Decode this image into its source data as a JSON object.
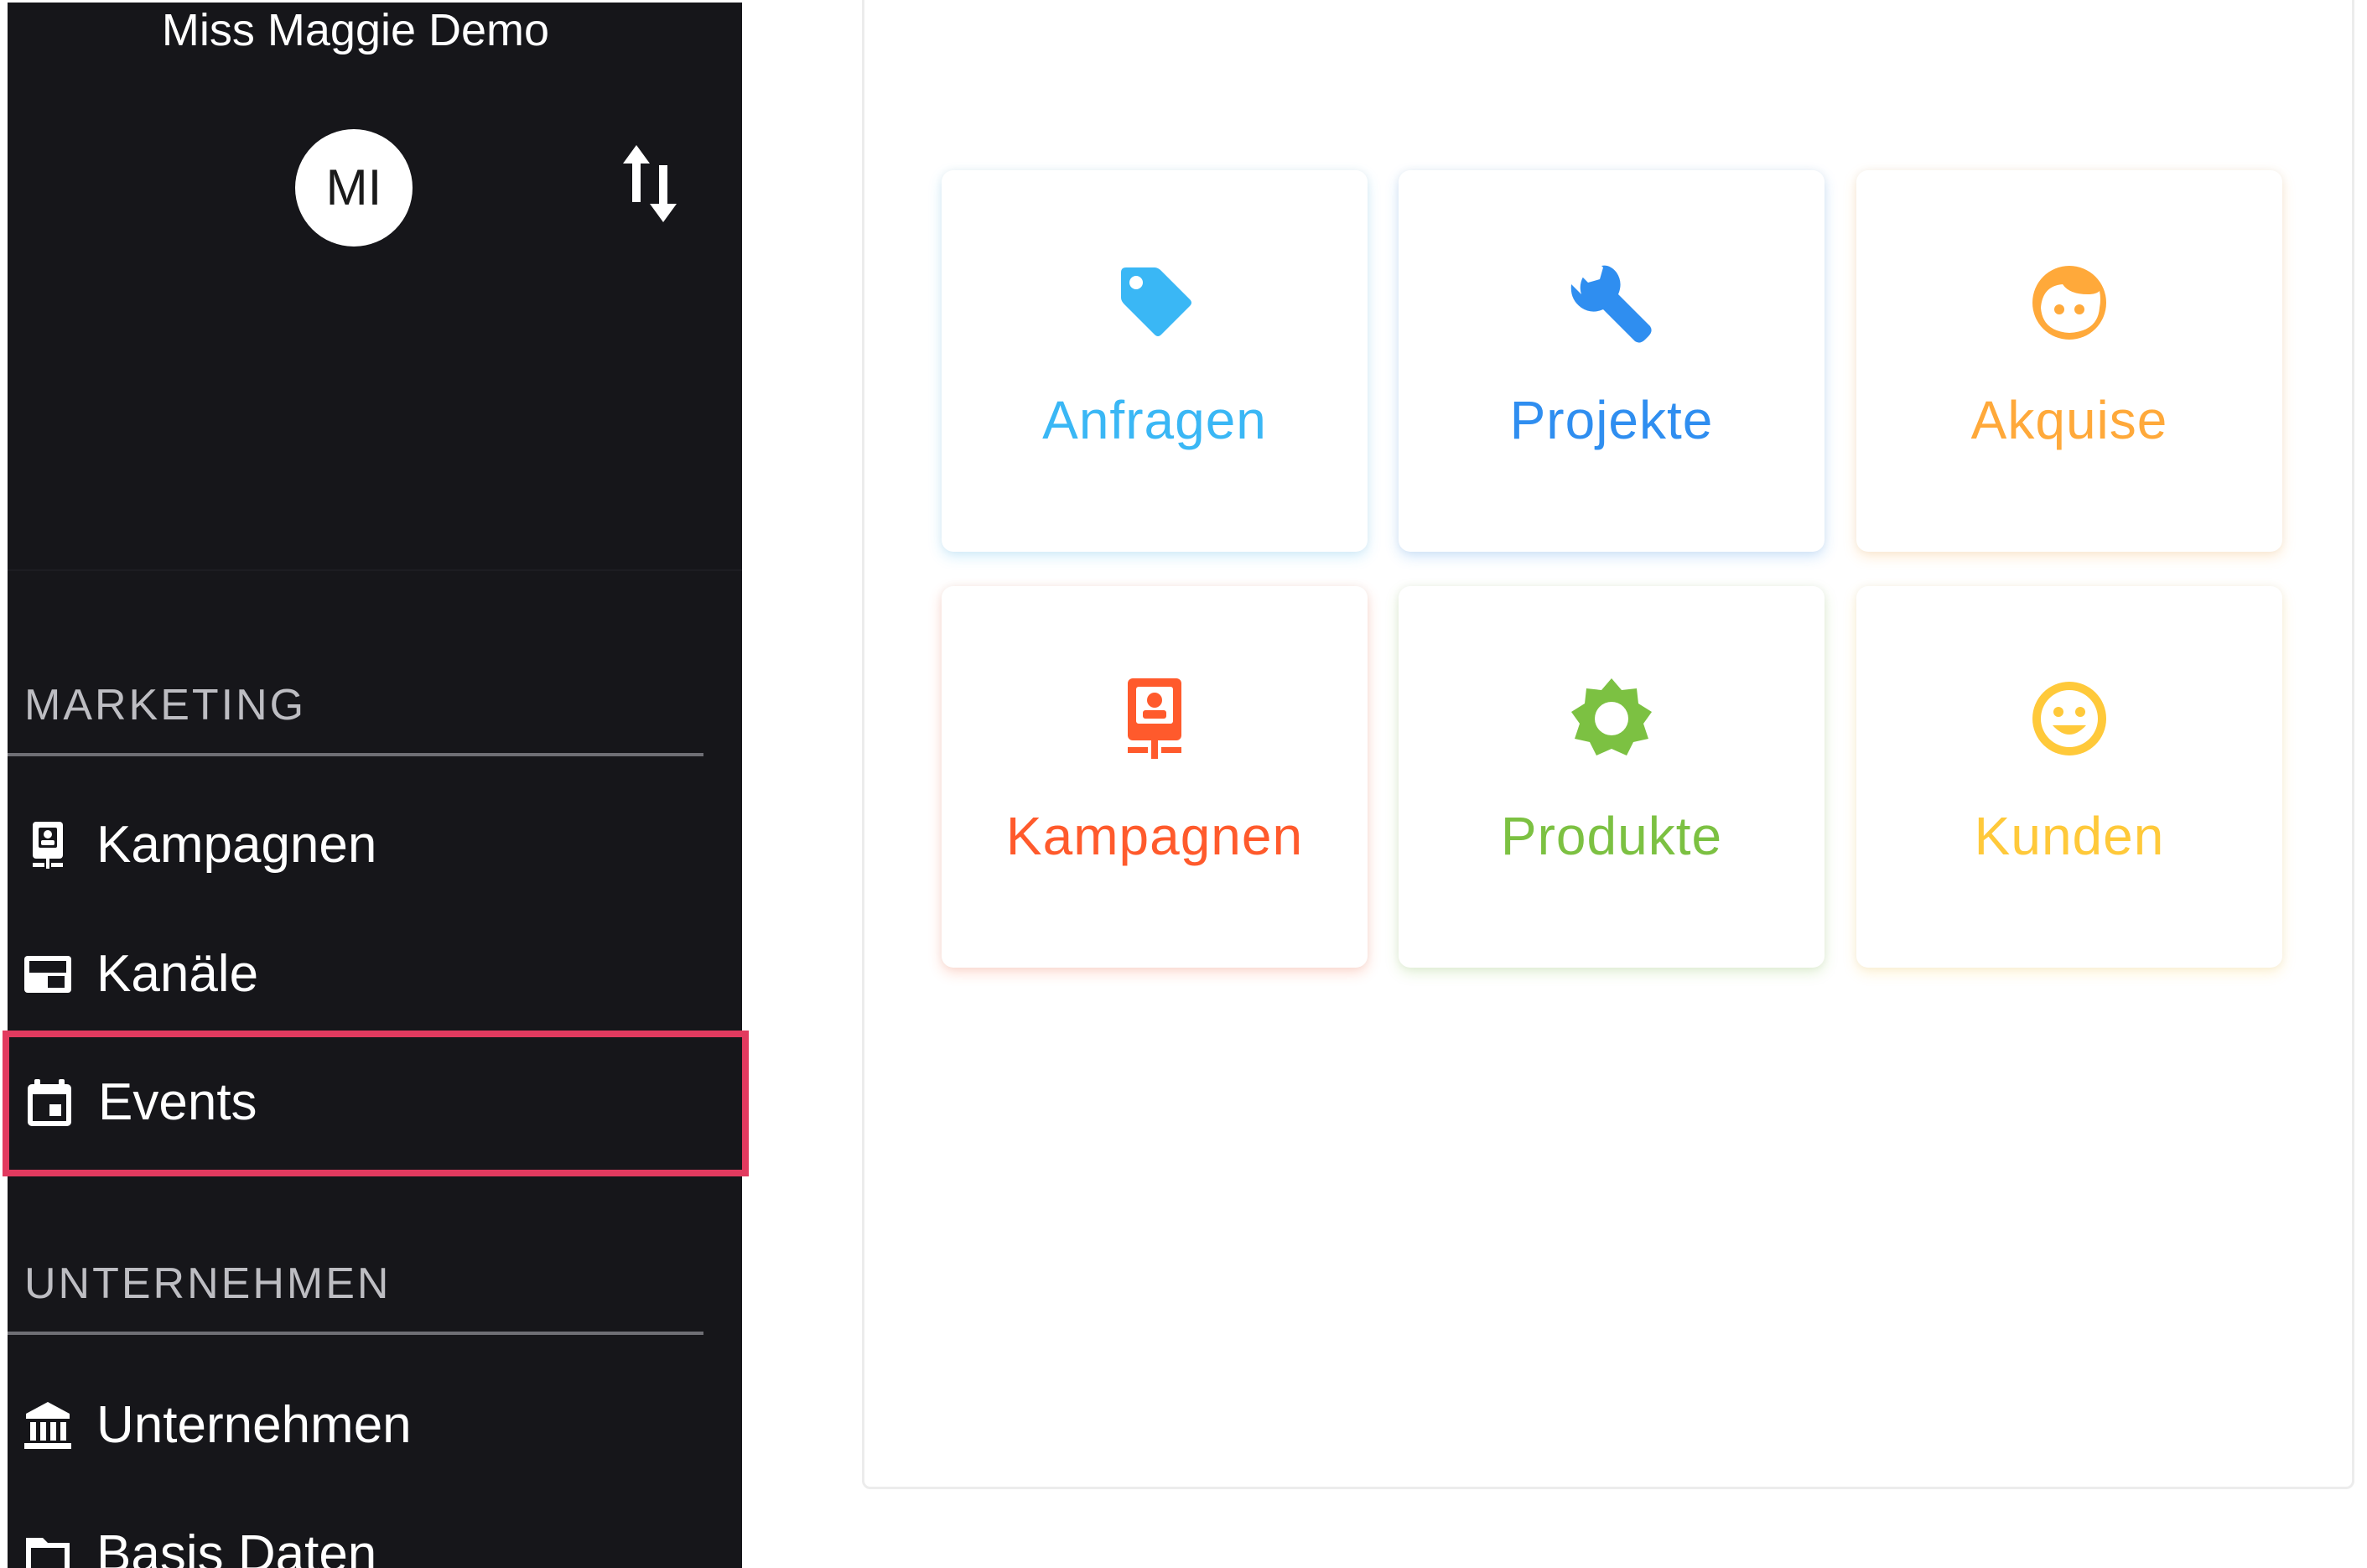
{
  "sidebar": {
    "org_name": "Miss Maggie Demo",
    "avatar_initials": "MI",
    "sections": [
      {
        "heading": "MARKETING",
        "items": [
          {
            "label": "Kampagnen",
            "icon": "campaign-icon"
          },
          {
            "label": "Kanäle",
            "icon": "channel-icon"
          },
          {
            "label": "Events",
            "icon": "calendar-icon",
            "selected": true
          }
        ]
      },
      {
        "heading": "UNTERNEHMEN",
        "items": [
          {
            "label": "Unternehmen",
            "icon": "bank-icon"
          },
          {
            "label": "Basis Daten",
            "icon": "folder-icon"
          }
        ]
      }
    ],
    "colors": {
      "background": "#16161a",
      "selection_border": "#e23a5f"
    }
  },
  "tiles": [
    {
      "label": "Anfragen",
      "icon": "tag-icon",
      "color": "#3ab7f5"
    },
    {
      "label": "Projekte",
      "icon": "wrench-icon",
      "color": "#2f8ef0"
    },
    {
      "label": "Akquise",
      "icon": "face-icon",
      "color": "#ffa93a"
    },
    {
      "label": "Kampagnen",
      "icon": "campaign-icon",
      "color": "#ff5a2c"
    },
    {
      "label": "Produkte",
      "icon": "gear-icon",
      "color": "#7cc142"
    },
    {
      "label": "Kunden",
      "icon": "smiley-icon",
      "color": "#ffc93a"
    }
  ]
}
